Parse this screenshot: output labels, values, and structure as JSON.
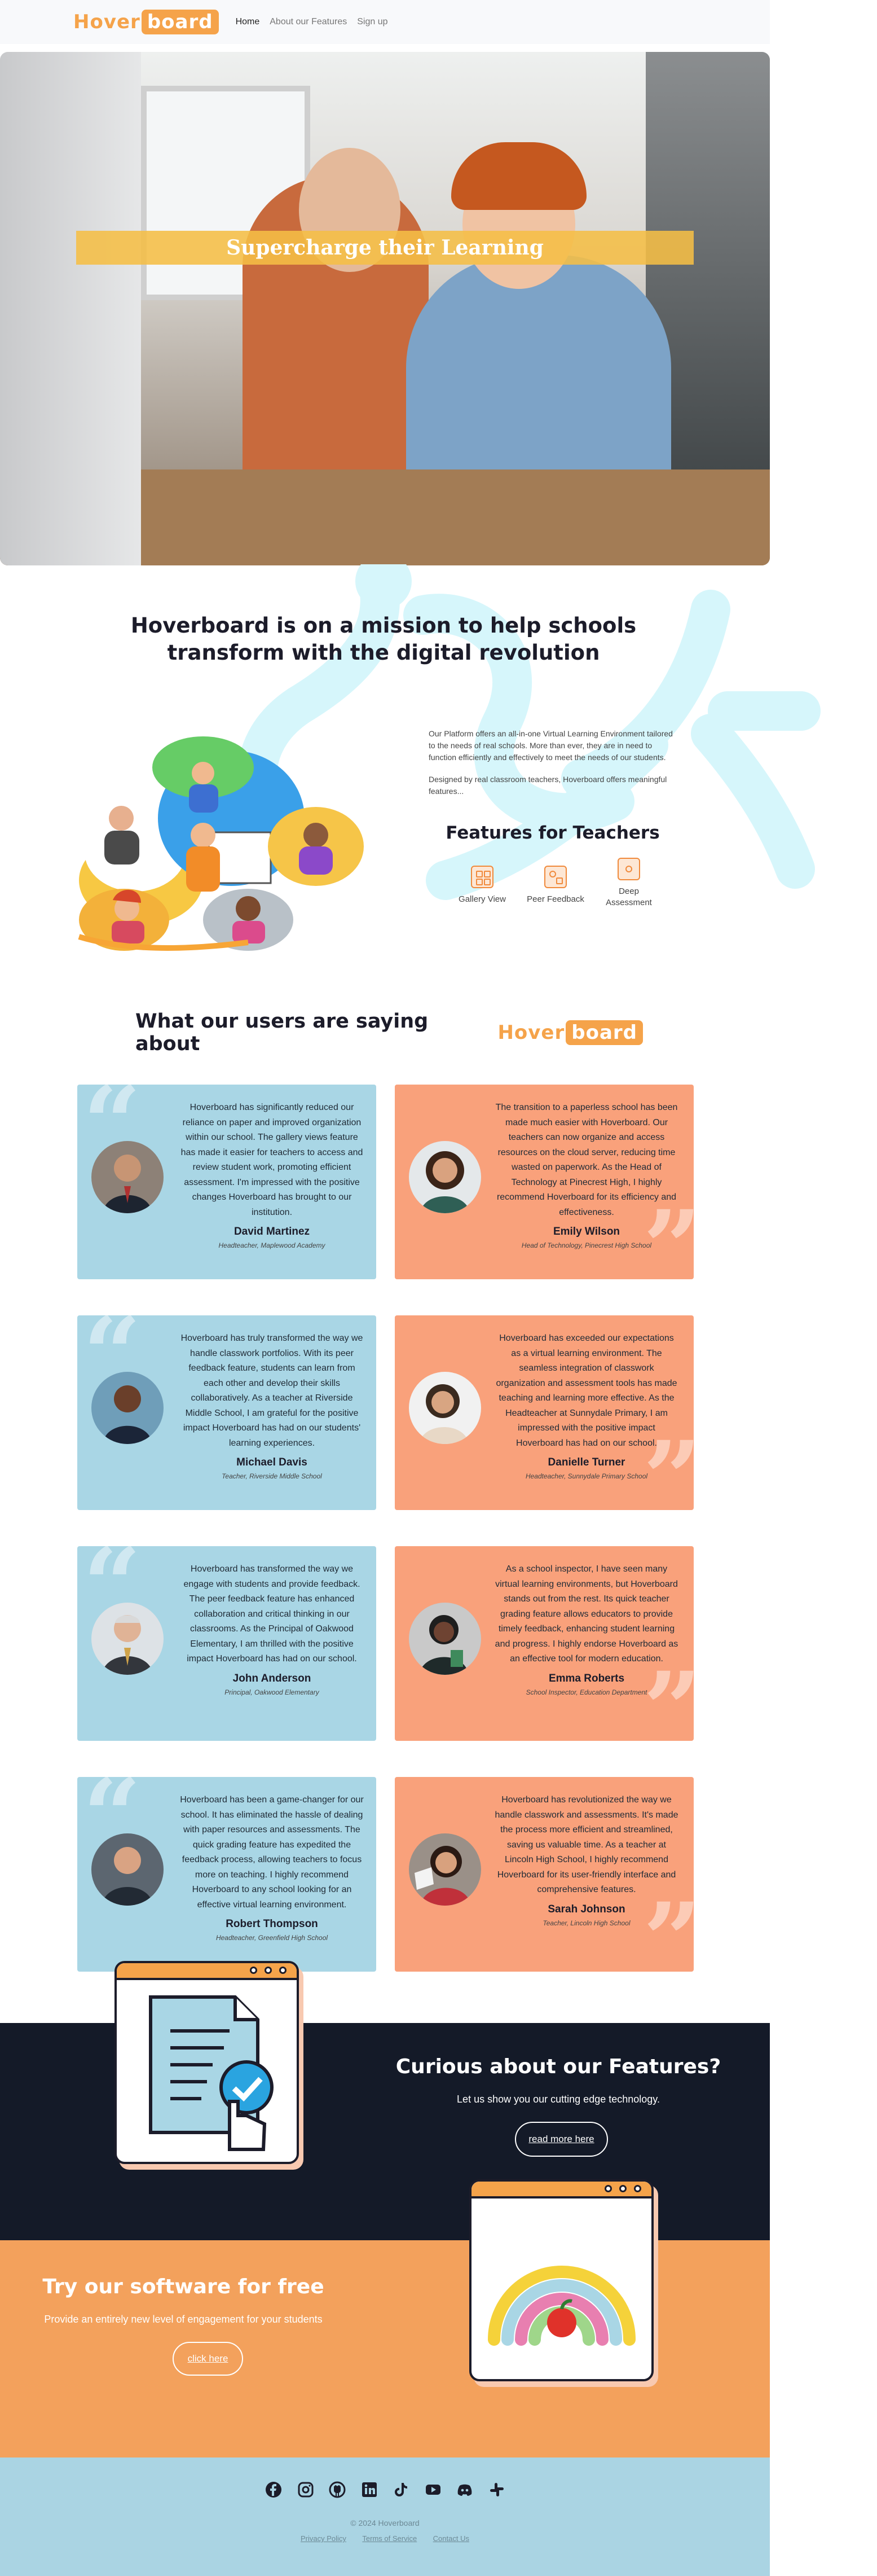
{
  "nav": {
    "logo_part1": "Hover",
    "logo_part2": "board",
    "links": [
      "Home",
      "About our Features",
      "Sign up"
    ]
  },
  "hero": {
    "banner": "Supercharge their Learning"
  },
  "mission": {
    "heading": "Hoverboard is on a mission to help schools transform with the digital revolution",
    "para1": "Our Platform offers an all-in-one Virtual Learning Environment tailored to the needs of real schools. More than ever, they are in need to function efficiently and effectively to meet the needs of our students.",
    "para2": "Designed by real classroom teachers, Hoverboard offers meaningful features...",
    "features_title": "Features for Teachers",
    "features": [
      "Gallery View",
      "Peer Feedback",
      "Deep Assessment"
    ]
  },
  "testimonials": {
    "heading": "What our users are saying about",
    "logo_part1": "Hover",
    "logo_part2": "board",
    "items": [
      {
        "text": "Hoverboard has significantly reduced our reliance on paper and improved organization within our school. The gallery views feature has made it easier for teachers to access and review student work, promoting efficient assessment. I'm impressed with the positive changes Hoverboard has brought to our institution.",
        "name": "David Martinez",
        "role": "Headteacher, Maplewood Academy"
      },
      {
        "text": "The transition to a paperless school has been made much easier with Hoverboard. Our teachers can now organize and access resources on the cloud server, reducing time wasted on paperwork. As the Head of Technology at Pinecrest High, I highly recommend Hoverboard for its efficiency and effectiveness.",
        "name": "Emily Wilson",
        "role": "Head of Technology, Pinecrest High School"
      },
      {
        "text": "Hoverboard has truly transformed the way we handle classwork portfolios. With its peer feedback feature, students can learn from each other and develop their skills collaboratively. As a teacher at Riverside Middle School, I am grateful for the positive impact Hoverboard has had on our students' learning experiences.",
        "name": "Michael Davis",
        "role": "Teacher, Riverside Middle School"
      },
      {
        "text": "Hoverboard has exceeded our expectations as a virtual learning environment. The seamless integration of classwork organization and assessment tools has made teaching and learning more effective. As the Headteacher at Sunnydale Primary, I am impressed with the positive impact Hoverboard has had on our school.",
        "name": "Danielle Turner",
        "role": "Headteacher, Sunnydale Primary School"
      },
      {
        "text": "Hoverboard has transformed the way we engage with students and provide feedback. The peer feedback feature has enhanced collaboration and critical thinking in our classrooms. As the Principal of Oakwood Elementary, I am thrilled with the positive impact Hoverboard has had on our school.",
        "name": "John Anderson",
        "role": "Principal, Oakwood Elementary"
      },
      {
        "text": "As a school inspector, I have seen many virtual learning environments, but Hoverboard stands out from the rest. Its quick teacher grading feature allows educators to provide timely feedback, enhancing student learning and progress. I highly endorse Hoverboard as an effective tool for modern education.",
        "name": "Emma Roberts",
        "role": "School Inspector, Education Department"
      },
      {
        "text": "Hoverboard has been a game-changer for our school. It has eliminated the hassle of dealing with paper resources and assessments. The quick grading feature has expedited the feedback process, allowing teachers to focus more on teaching. I highly recommend Hoverboard to any school looking for an effective virtual learning environment.",
        "name": "Robert Thompson",
        "role": "Headteacher, Greenfield High School"
      },
      {
        "text": "Hoverboard has revolutionized the way we handle classwork and assessments. It's made the process more efficient and streamlined, saving us valuable time. As a teacher at Lincoln High School, I highly recommend Hoverboard for its user-friendly interface and comprehensive features.",
        "name": "Sarah Johnson",
        "role": "Teacher, Lincoln High School"
      }
    ]
  },
  "cta_features": {
    "heading": "Curious about our Features?",
    "text": "Let us show you our cutting edge technology.",
    "button": "read more here"
  },
  "cta_try": {
    "heading": "Try our software for free",
    "text": "Provide an entirely new level of engagement for your students",
    "button": "click here"
  },
  "footer": {
    "socials": [
      "facebook-icon",
      "instagram-icon",
      "github-icon",
      "linkedin-icon",
      "tiktok-icon",
      "youtube-icon",
      "discord-icon",
      "slack-icon"
    ],
    "copyright": "© 2024 Hoverboard",
    "links": [
      "Privacy Policy",
      "Terms of Service",
      "Contact Us"
    ]
  },
  "colors": {
    "accent": "#f5a34a",
    "blue_card": "#a9d6e5",
    "orange_card": "#f9a17b",
    "dark": "#141a28",
    "footer": "#aad4e3"
  }
}
